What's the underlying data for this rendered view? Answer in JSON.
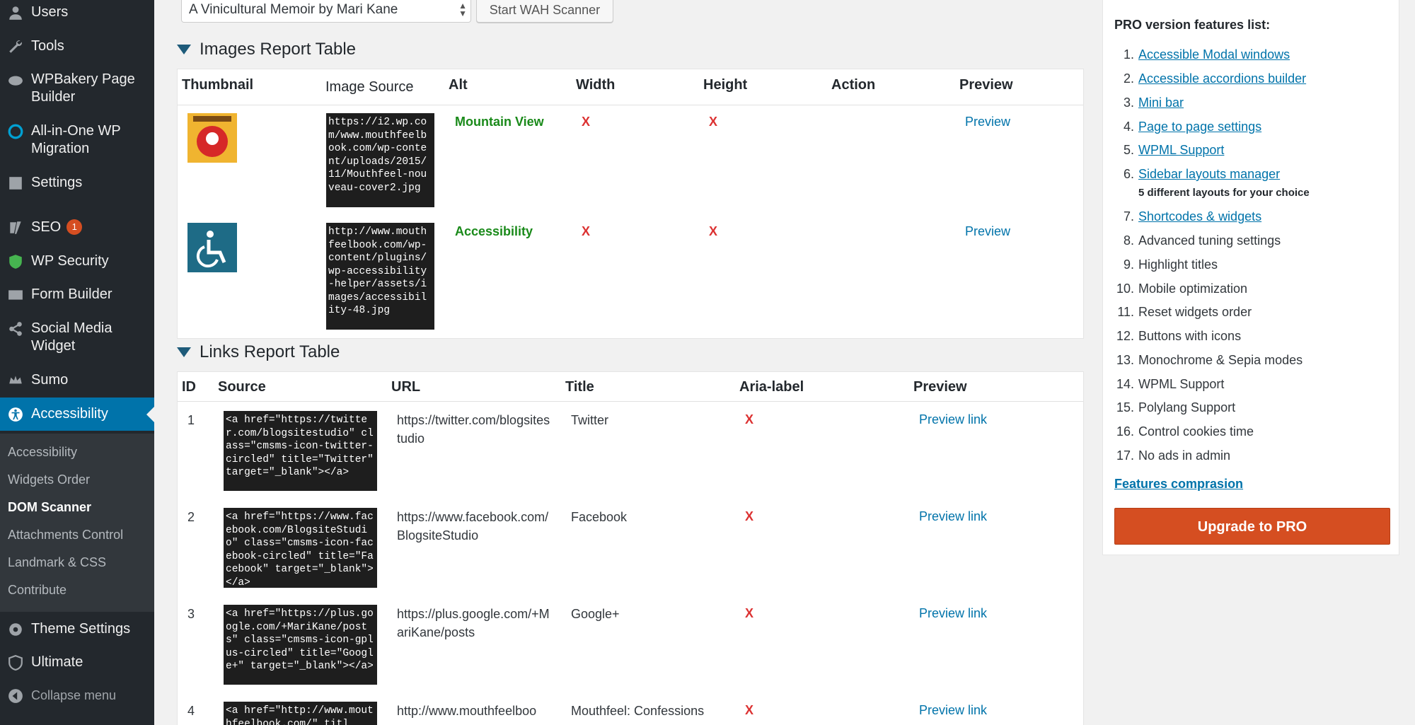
{
  "sidebar": {
    "items": [
      {
        "label": "Users",
        "icon": "users-icon"
      },
      {
        "label": "Tools",
        "icon": "tools-icon"
      },
      {
        "label": "WPBakery Page Builder",
        "icon": "wpbakery-icon"
      },
      {
        "label": "All-in-One WP Migration",
        "icon": "migration-icon"
      },
      {
        "label": "Settings",
        "icon": "settings-icon"
      },
      {
        "label": "SEO",
        "icon": "seo-icon",
        "badge": "1"
      },
      {
        "label": "WP Security",
        "icon": "shield-icon"
      },
      {
        "label": "Form Builder",
        "icon": "mail-icon"
      },
      {
        "label": "Social Media Widget",
        "icon": "share-icon"
      },
      {
        "label": "Sumo",
        "icon": "crown-icon"
      },
      {
        "label": "Accessibility",
        "icon": "accessibility-icon"
      },
      {
        "label": "Theme Settings",
        "icon": "gear-icon"
      },
      {
        "label": "Ultimate",
        "icon": "ultimate-icon"
      },
      {
        "label": "Collapse menu",
        "icon": "collapse-icon"
      }
    ],
    "submenu": [
      "Accessibility",
      "Widgets Order",
      "DOM Scanner",
      "Attachments Control",
      "Landmark & CSS",
      "Contribute"
    ]
  },
  "toolbar": {
    "select_value": "A Vinicultural Memoir by Mari Kane",
    "scan_button": "Start WAH Scanner"
  },
  "images_report": {
    "title": "Images Report Table",
    "headers": [
      "Thumbnail",
      "Image Source",
      "Alt",
      "Width",
      "Height",
      "Action",
      "Preview"
    ],
    "rows": [
      {
        "source": "https://i2.wp.com/www.mouthfeelbook.com/wp-content/uploads/2015/11/Mouthfeel-nouveau-cover2.jpg",
        "alt": "Mountain View",
        "width": "X",
        "height": "X",
        "preview": "Preview"
      },
      {
        "source": "http://www.mouthfeelbook.com/wp-content/plugins/wp-accessibility-helper/assets/images/accessibility-48.jpg",
        "alt": "Accessibility",
        "width": "X",
        "height": "X",
        "preview": "Preview"
      }
    ]
  },
  "links_report": {
    "title": "Links Report Table",
    "headers": [
      "ID",
      "Source",
      "URL",
      "Title",
      "Aria-label",
      "Preview"
    ],
    "rows": [
      {
        "id": "1",
        "source": "<a href=\"https://twitter.com/blogsitestudio\" class=\"cmsms-icon-twitter-circled\" title=\"Twitter\" target=\"_blank\"></a>",
        "url": "https://twitter.com/blogsitestudio",
        "title": "Twitter",
        "aria": "X",
        "preview": "Preview link"
      },
      {
        "id": "2",
        "source": "<a href=\"https://www.facebook.com/BlogsiteStudio\" class=\"cmsms-icon-facebook-circled\" title=\"Facebook\" target=\"_blank\"></a>",
        "url": "https://www.facebook.com/BlogsiteStudio",
        "title": "Facebook",
        "aria": "X",
        "preview": "Preview link"
      },
      {
        "id": "3",
        "source": "<a href=\"https://plus.google.com/+MariKane/posts\" class=\"cmsms-icon-gplus-circled\" title=\"Google+\" target=\"_blank\"></a>",
        "url": "https://plus.google.com/+MariKane/posts",
        "title": "Google+",
        "aria": "X",
        "preview": "Preview link"
      },
      {
        "id": "4",
        "source": "<a href=\"http://www.mouthfeelbook.com/\" titl",
        "url": "http://www.mouthfeelboo",
        "title": "Mouthfeel: Confessions",
        "aria": "X",
        "preview": "Preview link"
      }
    ]
  },
  "pro": {
    "title": "PRO version features list:",
    "features": [
      {
        "label": "Accessible Modal windows",
        "link": true
      },
      {
        "label": "Accessible accordions builder",
        "link": true
      },
      {
        "label": "Mini bar",
        "link": true
      },
      {
        "label": "Page to page settings",
        "link": true
      },
      {
        "label": "WPML Support",
        "link": true
      },
      {
        "label": "Sidebar layouts manager",
        "link": true,
        "note": "5 different layouts for your choice"
      },
      {
        "label": "Shortcodes & widgets",
        "link": true
      },
      {
        "label": "Advanced tuning settings",
        "link": false
      },
      {
        "label": "Highlight titles",
        "link": false
      },
      {
        "label": "Mobile optimization",
        "link": false
      },
      {
        "label": "Reset widgets order",
        "link": false
      },
      {
        "label": "Buttons with icons",
        "link": false
      },
      {
        "label": "Monochrome & Sepia modes",
        "link": false
      },
      {
        "label": "WPML Support",
        "link": false
      },
      {
        "label": "Polylang Support",
        "link": false
      },
      {
        "label": "Control cookies time",
        "link": false
      },
      {
        "label": "No ads in admin",
        "link": false
      }
    ],
    "compare_link": "Features comprasion",
    "upgrade_button": "Upgrade to PRO"
  },
  "colors": {
    "sidebar_bg": "#23282d",
    "active": "#0073aa",
    "upgrade": "#d54e21",
    "alt_text": "#1a8a1a",
    "error": "#dc3232"
  }
}
